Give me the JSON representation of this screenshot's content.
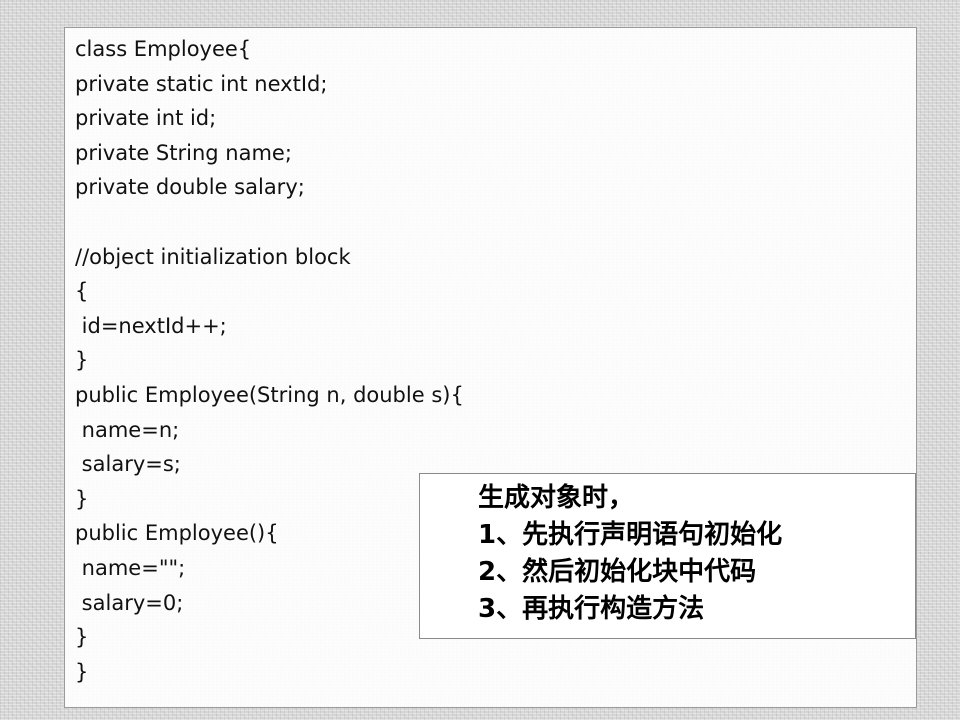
{
  "code": {
    "lines": [
      "class Employee{",
      "private static int nextId;",
      "private int id;",
      "private String name;",
      "private double salary;",
      "",
      "//object initialization block",
      "{",
      " id=nextId++;",
      "}",
      "public Employee(String n, double s){",
      " name=n;",
      " salary=s;",
      "}",
      "public Employee(){",
      " name=\"\";",
      " salary=0;",
      "}",
      "}"
    ]
  },
  "note": {
    "lines": [
      "生成对象时，",
      "1、先执行声明语句初始化",
      "2、然后初始化块中代码",
      "3、再执行构造方法"
    ]
  }
}
